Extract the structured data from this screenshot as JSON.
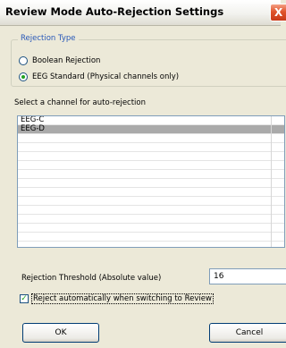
{
  "window": {
    "title": "Review Mode Auto-Rejection Settings",
    "close_glyph": "X"
  },
  "rejection_type": {
    "legend": "Rejection Type",
    "options": [
      {
        "label": "Boolean Rejection",
        "selected": false
      },
      {
        "label": "EEG Standard (Physical channels only)",
        "selected": true
      }
    ]
  },
  "channel_select": {
    "label": "Select a channel for auto-rejection",
    "items": [
      {
        "label": "EEG-C",
        "selected": false
      },
      {
        "label": "EEG-D",
        "selected": true
      }
    ]
  },
  "threshold": {
    "label": "Rejection Threshold (Absolute value)",
    "value": "16"
  },
  "auto_reject": {
    "label": "Reject automatically when switching to Review",
    "checked": true
  },
  "buttons": {
    "ok": "OK",
    "cancel": "Cancel"
  },
  "colors": {
    "group_legend": "#2858b8",
    "radio_dot": "#21a121",
    "selected_row": "#aaaaaa"
  }
}
